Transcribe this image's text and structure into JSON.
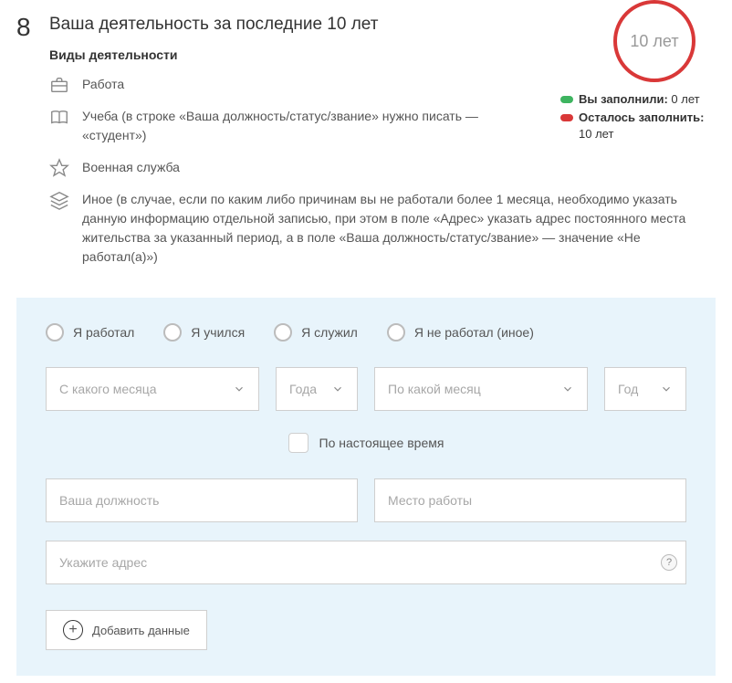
{
  "step": "8",
  "title": "Ваша деятельность за последние 10 лет",
  "subtitle": "Виды деятельности",
  "circle_text": "10 лет",
  "status": {
    "filled_label": "Вы заполнили:",
    "filled_value": "0 лет",
    "remaining_label": "Осталось заполнить:",
    "remaining_value": "10 лет"
  },
  "activities": {
    "work": "Работа",
    "study": "Учеба (в строке «Ваша должность/статус/звание» нужно писать — «студент»)",
    "military": "Военная служба",
    "other": "Иное (в случае, если по каким либо причинам вы не работали более 1 месяца, необходимо указать данную информацию отдельной записью, при этом в поле «Адрес» указать адрес постоянного места жительства за указанный период, а в поле «Ваша должность/статус/звание» — значение «Не работал(а)»)"
  },
  "radios": {
    "worked": "Я работал",
    "studied": "Я учился",
    "served": "Я служил",
    "notworked": "Я не работал (иное)"
  },
  "selects": {
    "from_month": "С какого месяца",
    "from_year": "Года",
    "to_month": "По какой месяц",
    "to_year": "Год"
  },
  "checkbox_present": "По настоящее время",
  "inputs": {
    "position": "Ваша должность",
    "workplace": "Место работы",
    "address": "Укажите адрес"
  },
  "help_symbol": "?",
  "add_button": "Добавить данные"
}
